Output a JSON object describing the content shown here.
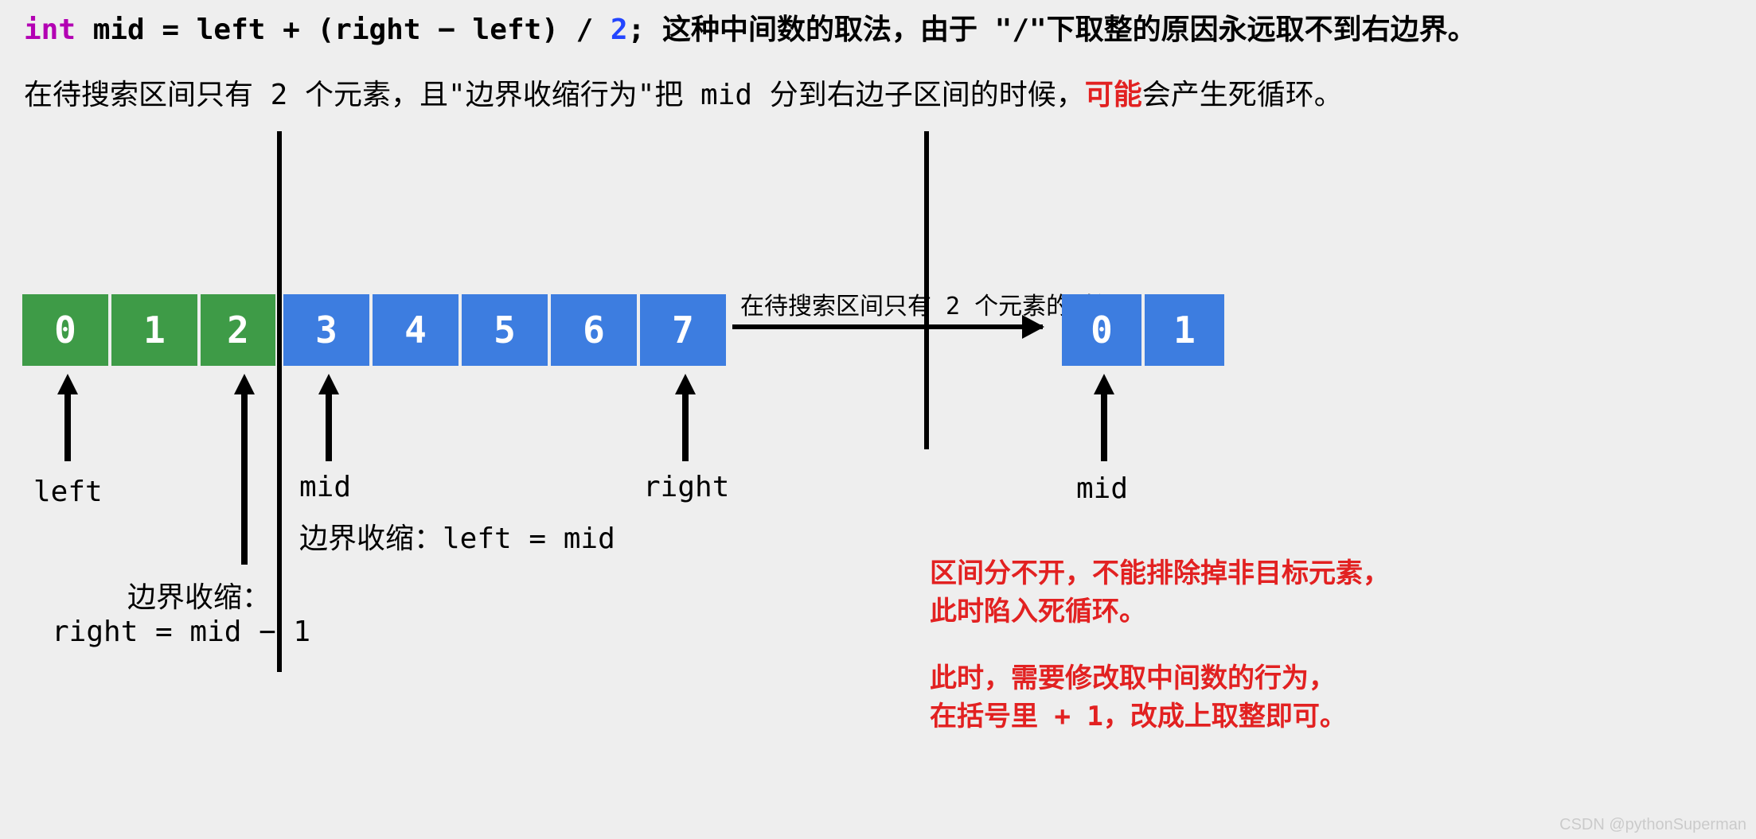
{
  "code": {
    "kw": "int",
    "rest1": " mid = left + (right − left) / ",
    "num": "2",
    "rest2": ";",
    "explain": " 这种中间数的取法，由于 \"/\"下取整的原因永远取不到右边界。"
  },
  "line2": {
    "a": "在待搜索区间只有 2 个元素，且\"边界收缩行为\"把 mid 分到右边子区间的时候，",
    "b": "可能",
    "c": "会产生死循环。"
  },
  "cells": [
    "0",
    "1",
    "2",
    "3",
    "4",
    "5",
    "6",
    "7"
  ],
  "cell_colors": [
    "green",
    "green",
    "green",
    "blue",
    "blue",
    "blue",
    "blue",
    "blue"
  ],
  "labels": {
    "left": "left",
    "mid": "mid",
    "right": "right",
    "shrink_left_title": "边界收缩：",
    "shrink_left_expr": "right = mid − 1",
    "shrink_mid": "边界收缩：left = mid",
    "harrow": "在待搜索区间只有 2 个元素的时候"
  },
  "small_cells": [
    "0",
    "1"
  ],
  "small_mid": "mid",
  "red1a": "区间分不开，不能排除掉非目标元素，",
  "red1b": "此时陷入死循环。",
  "red2a": "此时，需要修改取中间数的行为，",
  "red2b": "在括号里 + 1，改成上取整即可。",
  "watermark": "CSDN @pythonSuperman",
  "chart_data": {
    "type": "diagram",
    "description": "Binary search mid calculation with floor division showing potential infinite loop when 2 elements remain",
    "main_array": {
      "indices": [
        0,
        1,
        2,
        3,
        4,
        5,
        6,
        7
      ],
      "left_region": [
        0,
        1,
        2
      ],
      "right_region": [
        3,
        4,
        5,
        6,
        7
      ],
      "left_pointer": 0,
      "mid_pointer": 3,
      "right_pointer": 7,
      "shrink_rule_left_region": "right = mid - 1",
      "shrink_rule_right_region": "left = mid"
    },
    "reduced_array": {
      "indices": [
        0,
        1
      ],
      "mid_pointer": 0,
      "issue": "interval cannot split → infinite loop",
      "fix": "use ceil: add +1 inside parentheses"
    }
  }
}
